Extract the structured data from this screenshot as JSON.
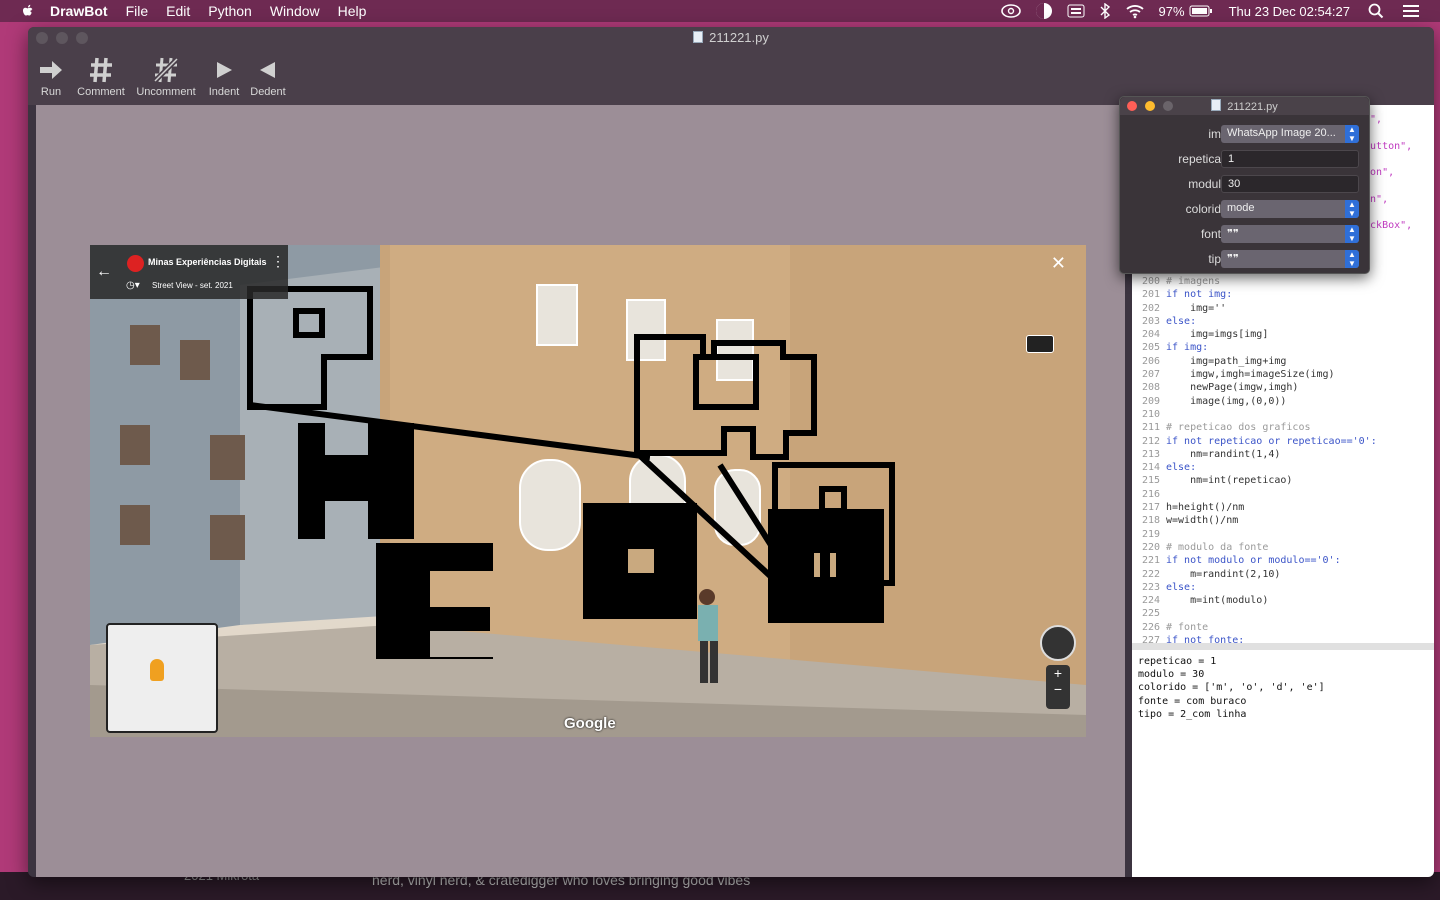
{
  "menubar": {
    "app": "DrawBot",
    "items": [
      "File",
      "Edit",
      "Python",
      "Window",
      "Help"
    ],
    "battery": "97%",
    "datetime": "Thu 23 Dec  02:54:27"
  },
  "desktop": {
    "bg_text": "nerd, vinyl nerd, & cratedigger who loves bringing good vibes",
    "bg_text2": "2021 Mikrota"
  },
  "window": {
    "title": "211221.py",
    "toolbar": [
      {
        "label": "Run",
        "icon": "run-arrow-icon"
      },
      {
        "label": "Comment",
        "icon": "hash-icon"
      },
      {
        "label": "Uncomment",
        "icon": "hash-slash-icon"
      },
      {
        "label": "Indent",
        "icon": "indent-triangle-icon"
      },
      {
        "label": "Dedent",
        "icon": "dedent-triangle-icon"
      }
    ]
  },
  "streetview": {
    "place": "Minas Experiências Digitais",
    "date": "Street View - set. 2021",
    "brand": "Google"
  },
  "panel": {
    "title": "211221.py",
    "fields": [
      {
        "label": "img:",
        "value": "WhatsApp Image 20...",
        "kind": "popup"
      },
      {
        "label": "repeticao:",
        "value": "1",
        "kind": "text"
      },
      {
        "label": "modulo:",
        "value": "30",
        "kind": "text"
      },
      {
        "label": "colorido:",
        "value": "mode",
        "kind": "popup"
      },
      {
        "label": "fonte:",
        "value": "❞❞",
        "kind": "popup"
      },
      {
        "label": "tipo:",
        "value": "❞❞",
        "kind": "popup"
      }
    ]
  },
  "code_hidden": [
    "xt\",",
    "pButton\",",
    "tton\",",
    "ton\",",
    "heckBox\","
  ],
  "code": [
    {
      "n": "200",
      "t": "# imagens"
    },
    {
      "n": "201",
      "t": "if not img:"
    },
    {
      "n": "202",
      "t": "    img=''"
    },
    {
      "n": "203",
      "t": "else:"
    },
    {
      "n": "204",
      "t": "    img=imgs[img]"
    },
    {
      "n": "205",
      "t": "if img:"
    },
    {
      "n": "206",
      "t": "    img=path_img+img"
    },
    {
      "n": "207",
      "t": "    imgw,imgh=imageSize(img)"
    },
    {
      "n": "208",
      "t": "    newPage(imgw,imgh)"
    },
    {
      "n": "209",
      "t": "    image(img,(0,0))"
    },
    {
      "n": "210",
      "t": ""
    },
    {
      "n": "211",
      "t": "# repeticao dos graficos"
    },
    {
      "n": "212",
      "t": "if not repeticao or repeticao=='0':"
    },
    {
      "n": "213",
      "t": "    nm=randint(1,4)"
    },
    {
      "n": "214",
      "t": "else:"
    },
    {
      "n": "215",
      "t": "    nm=int(repeticao)"
    },
    {
      "n": "216",
      "t": ""
    },
    {
      "n": "217",
      "t": "h=height()/nm"
    },
    {
      "n": "218",
      "t": "w=width()/nm"
    },
    {
      "n": "219",
      "t": ""
    },
    {
      "n": "220",
      "t": "# modulo da fonte"
    },
    {
      "n": "221",
      "t": "if not modulo or modulo=='0':"
    },
    {
      "n": "222",
      "t": "    m=randint(2,10)"
    },
    {
      "n": "223",
      "t": "else:"
    },
    {
      "n": "224",
      "t": "    m=int(modulo)"
    },
    {
      "n": "225",
      "t": ""
    },
    {
      "n": "226",
      "t": "# fonte"
    },
    {
      "n": "227",
      "t": "if not fonte:"
    }
  ],
  "output": [
    "repeticao = 1",
    "modulo = 30",
    "colorido = ['m', 'o', 'd', 'e']",
    "fonte = com buraco",
    "tipo = 2_com linha"
  ],
  "colors": {
    "menubar": "#6e2a52",
    "desktop": "#b03a78",
    "canvas": "#9c8e97",
    "accent": "#2f6fd8"
  }
}
